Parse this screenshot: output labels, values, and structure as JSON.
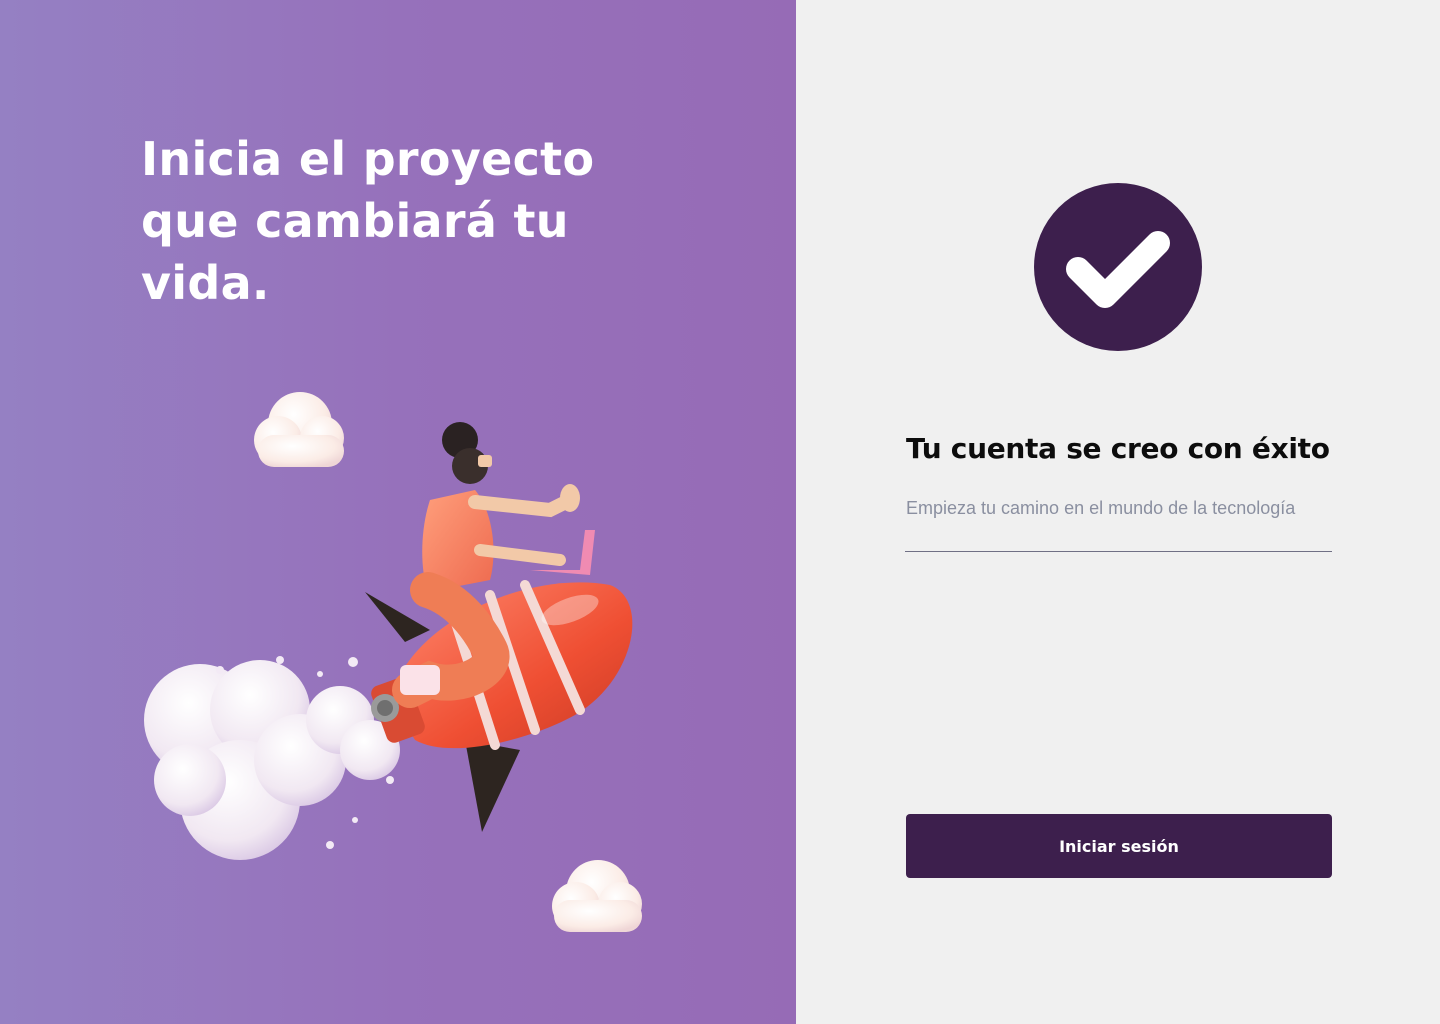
{
  "hero": {
    "title": "Inicia el proyecto que cambiará tu vida.",
    "illustration_icon": "rocket-rider-illustration"
  },
  "success": {
    "icon": "check-circle-icon",
    "title": "Tu cuenta se creo con éxito",
    "subtitle": "Empieza tu camino en el mundo de la tecnología"
  },
  "actions": {
    "login_label": "Iniciar sesión"
  },
  "colors": {
    "brand_dark": "#3d1f4d",
    "gradient_start": "#9580c3",
    "gradient_end": "#966bb6",
    "background": "#f0f0f0",
    "subtitle": "#8a8fa0"
  }
}
